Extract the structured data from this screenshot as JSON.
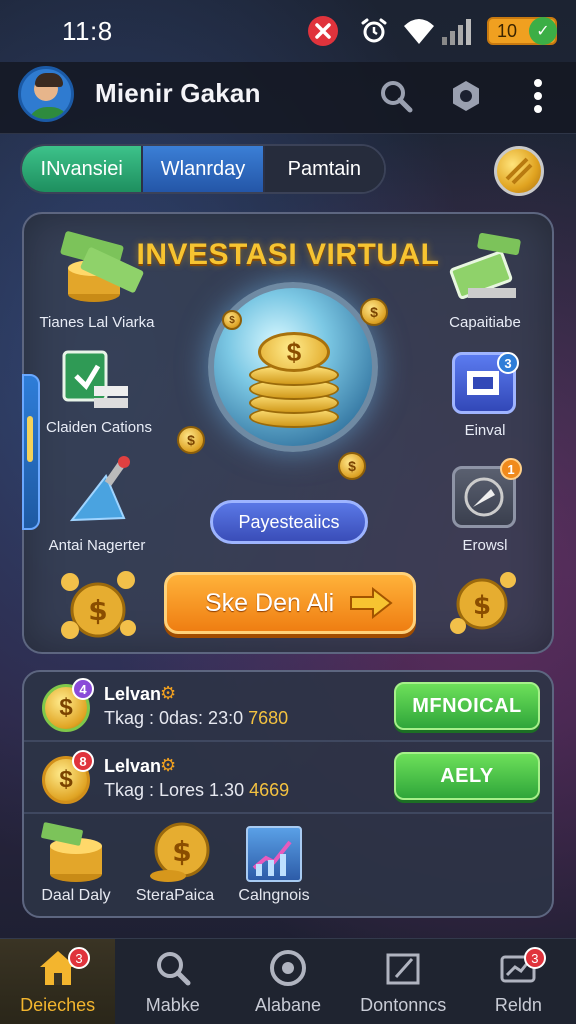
{
  "status": {
    "time": "11:8",
    "battery": "10"
  },
  "header": {
    "username": "Mienir Gakan"
  },
  "tabs": [
    "INvansiei",
    "Wlanrday",
    "Pamtain"
  ],
  "main": {
    "title": "INVESTASI VIRTUAL",
    "features": {
      "top_left": "Tianes Lal Viarka",
      "mid_left": "Claiden Cations",
      "bottom_left": "Antai Nagerter",
      "top_right": "Capaitiabe",
      "mid_right": "Einval",
      "bottom_right": "Erowsl"
    },
    "feature_badges": {
      "mid_right": "3",
      "bottom_right": "1"
    },
    "pill_label": "Payesteaiics",
    "cta_label": "Ske Den Ali"
  },
  "list": {
    "rows": [
      {
        "name": "Lelvan",
        "sub_prefix": "Tkag : 0das: 23:0 ",
        "sub_num": "7680",
        "button": "MFNOICAL",
        "badge": "4"
      },
      {
        "name": "Lelvan",
        "sub_prefix": "Tkag : Lores 1.30 ",
        "sub_num": "4669",
        "button": "AELY",
        "badge": "8"
      }
    ],
    "shortcuts": [
      "Daal Daly",
      "SteraPaica",
      "Calngnois"
    ]
  },
  "bottom_nav": [
    {
      "label": "Deieches",
      "badge": "3",
      "icon": "home-icon"
    },
    {
      "label": "Mabke",
      "badge": "",
      "icon": "search-icon"
    },
    {
      "label": "Alabane",
      "badge": "",
      "icon": "target-icon"
    },
    {
      "label": "Dontonncs",
      "badge": "",
      "icon": "edit-icon"
    },
    {
      "label": "Reldn",
      "badge": "3",
      "icon": "chart-mail-icon"
    }
  ],
  "colors": {
    "accent_gold": "#f7c431",
    "accent_green": "#3cae46",
    "accent_orange": "#ef7e12",
    "accent_blue": "#3b7fd6"
  }
}
